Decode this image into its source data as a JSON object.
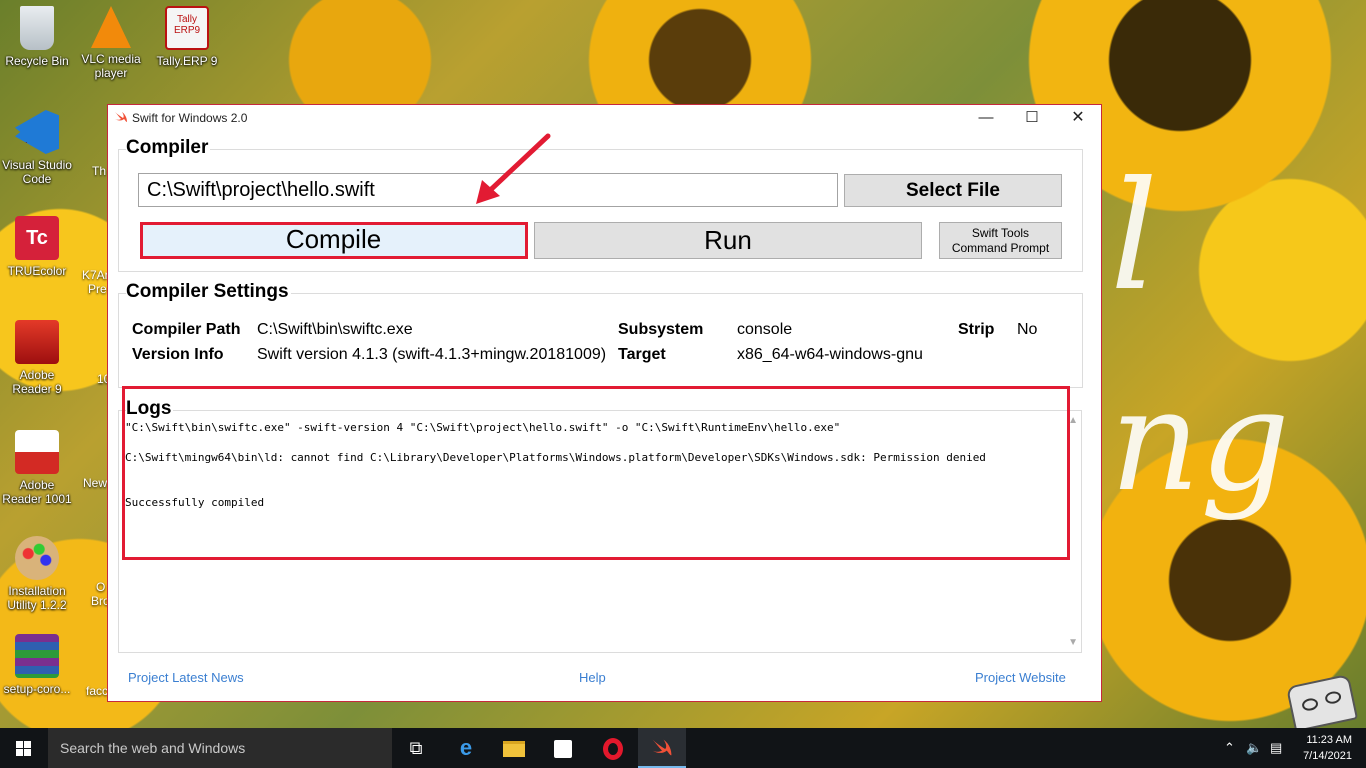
{
  "desktop": {
    "icons": [
      {
        "label": "Recycle Bin"
      },
      {
        "label": "VLC media player"
      },
      {
        "label": "Tally.ERP 9"
      },
      {
        "label": "Visual Studio Code"
      },
      {
        "label": "TRUEcolor"
      },
      {
        "label": "Adobe Reader 9"
      },
      {
        "label": "Adobe Reader 1001"
      },
      {
        "label": "Installation Utility 1.2.2"
      },
      {
        "label": "setup-coro..."
      }
    ],
    "partial_labels": [
      "Th",
      "K7Ar",
      "Pre",
      "10",
      "New",
      "O",
      "Bro",
      "facc"
    ],
    "tally_icon_text": "Tally ERP9",
    "truecolor_icon_text": "Tc"
  },
  "window": {
    "title": "Swift for Windows 2.0",
    "controls": {
      "minimize": "—",
      "maximize": "☐",
      "close": "✕"
    },
    "compiler": {
      "section_title": "Compiler",
      "file_path": "C:\\Swift\\project\\hello.swift",
      "select_file_label": "Select File",
      "compile_label": "Compile",
      "run_label": "Run",
      "tools_label_line1": "Swift Tools",
      "tools_label_line2": "Command Prompt"
    },
    "settings": {
      "section_title": "Compiler Settings",
      "compiler_path_label": "Compiler Path",
      "compiler_path_value": "C:\\Swift\\bin\\swiftc.exe",
      "version_info_label": "Version Info",
      "version_info_value": "Swift version 4.1.3 (swift-4.1.3+mingw.20181009)",
      "subsystem_label": "Subsystem",
      "subsystem_value": "console",
      "target_label": "Target",
      "target_value": "x86_64-w64-windows-gnu",
      "strip_label": "Strip",
      "strip_value": "No"
    },
    "logs": {
      "section_title": "Logs",
      "lines": [
        "\"C:\\Swift\\bin\\swiftc.exe\" -swift-version 4 \"C:\\Swift\\project\\hello.swift\" -o \"C:\\Swift\\RuntimeEnv\\hello.exe\"",
        "C:\\Swift\\mingw64\\bin\\ld: cannot find C:\\Library\\Developer\\Platforms\\Windows.platform\\Developer\\SDKs\\Windows.sdk: Permission denied",
        "Successfully compiled"
      ]
    },
    "footer": {
      "news_link": "Project Latest News",
      "help_link": "Help",
      "website_link": "Project Website"
    }
  },
  "taskbar": {
    "search_placeholder": "Search the web and Windows",
    "time": "11:23 AM",
    "date": "7/14/2021"
  },
  "colors": {
    "highlight_red": "#e21b33",
    "link_blue": "#3b7fd1",
    "button_gray": "#e1e1e1",
    "taskbar": "#111417"
  }
}
